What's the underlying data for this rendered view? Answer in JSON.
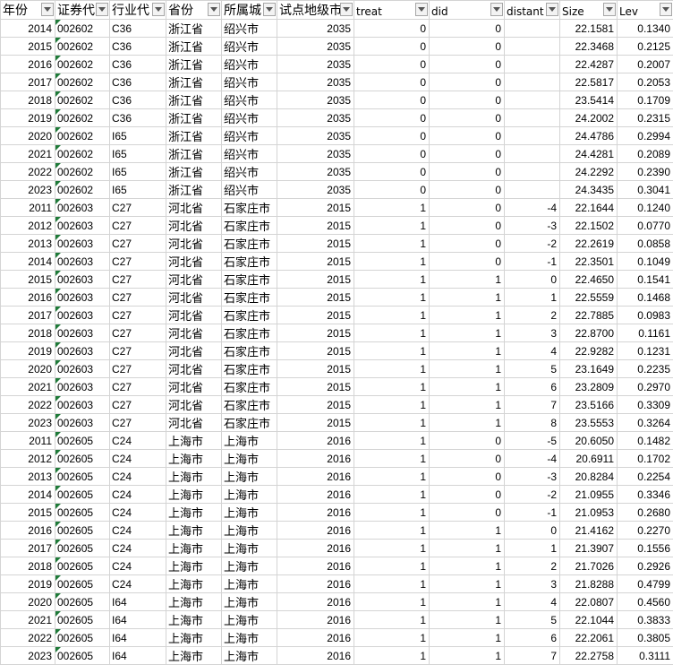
{
  "columns": [
    "年份",
    "证券代",
    "行业代",
    "省份",
    "所属城",
    "试点地级市",
    "treat",
    "did",
    "distant",
    "Size",
    "Lev"
  ],
  "rows": [
    [
      "2014",
      "002602",
      "C36",
      "浙江省",
      "绍兴市",
      "2035",
      "0",
      "0",
      "",
      "22.1581",
      "0.1340"
    ],
    [
      "2015",
      "002602",
      "C36",
      "浙江省",
      "绍兴市",
      "2035",
      "0",
      "0",
      "",
      "22.3468",
      "0.2125"
    ],
    [
      "2016",
      "002602",
      "C36",
      "浙江省",
      "绍兴市",
      "2035",
      "0",
      "0",
      "",
      "22.4287",
      "0.2007"
    ],
    [
      "2017",
      "002602",
      "C36",
      "浙江省",
      "绍兴市",
      "2035",
      "0",
      "0",
      "",
      "22.5817",
      "0.2053"
    ],
    [
      "2018",
      "002602",
      "C36",
      "浙江省",
      "绍兴市",
      "2035",
      "0",
      "0",
      "",
      "23.5414",
      "0.1709"
    ],
    [
      "2019",
      "002602",
      "C36",
      "浙江省",
      "绍兴市",
      "2035",
      "0",
      "0",
      "",
      "24.2002",
      "0.2315"
    ],
    [
      "2020",
      "002602",
      "I65",
      "浙江省",
      "绍兴市",
      "2035",
      "0",
      "0",
      "",
      "24.4786",
      "0.2994"
    ],
    [
      "2021",
      "002602",
      "I65",
      "浙江省",
      "绍兴市",
      "2035",
      "0",
      "0",
      "",
      "24.4281",
      "0.2089"
    ],
    [
      "2022",
      "002602",
      "I65",
      "浙江省",
      "绍兴市",
      "2035",
      "0",
      "0",
      "",
      "24.2292",
      "0.2390"
    ],
    [
      "2023",
      "002602",
      "I65",
      "浙江省",
      "绍兴市",
      "2035",
      "0",
      "0",
      "",
      "24.3435",
      "0.3041"
    ],
    [
      "2011",
      "002603",
      "C27",
      "河北省",
      "石家庄市",
      "2015",
      "1",
      "0",
      "-4",
      "22.1644",
      "0.1240"
    ],
    [
      "2012",
      "002603",
      "C27",
      "河北省",
      "石家庄市",
      "2015",
      "1",
      "0",
      "-3",
      "22.1502",
      "0.0770"
    ],
    [
      "2013",
      "002603",
      "C27",
      "河北省",
      "石家庄市",
      "2015",
      "1",
      "0",
      "-2",
      "22.2619",
      "0.0858"
    ],
    [
      "2014",
      "002603",
      "C27",
      "河北省",
      "石家庄市",
      "2015",
      "1",
      "0",
      "-1",
      "22.3501",
      "0.1049"
    ],
    [
      "2015",
      "002603",
      "C27",
      "河北省",
      "石家庄市",
      "2015",
      "1",
      "1",
      "0",
      "22.4650",
      "0.1541"
    ],
    [
      "2016",
      "002603",
      "C27",
      "河北省",
      "石家庄市",
      "2015",
      "1",
      "1",
      "1",
      "22.5559",
      "0.1468"
    ],
    [
      "2017",
      "002603",
      "C27",
      "河北省",
      "石家庄市",
      "2015",
      "1",
      "1",
      "2",
      "22.7885",
      "0.0983"
    ],
    [
      "2018",
      "002603",
      "C27",
      "河北省",
      "石家庄市",
      "2015",
      "1",
      "1",
      "3",
      "22.8700",
      "0.1161"
    ],
    [
      "2019",
      "002603",
      "C27",
      "河北省",
      "石家庄市",
      "2015",
      "1",
      "1",
      "4",
      "22.9282",
      "0.1231"
    ],
    [
      "2020",
      "002603",
      "C27",
      "河北省",
      "石家庄市",
      "2015",
      "1",
      "1",
      "5",
      "23.1649",
      "0.2235"
    ],
    [
      "2021",
      "002603",
      "C27",
      "河北省",
      "石家庄市",
      "2015",
      "1",
      "1",
      "6",
      "23.2809",
      "0.2970"
    ],
    [
      "2022",
      "002603",
      "C27",
      "河北省",
      "石家庄市",
      "2015",
      "1",
      "1",
      "7",
      "23.5166",
      "0.3309"
    ],
    [
      "2023",
      "002603",
      "C27",
      "河北省",
      "石家庄市",
      "2015",
      "1",
      "1",
      "8",
      "23.5553",
      "0.3264"
    ],
    [
      "2011",
      "002605",
      "C24",
      "上海市",
      "上海市",
      "2016",
      "1",
      "0",
      "-5",
      "20.6050",
      "0.1482"
    ],
    [
      "2012",
      "002605",
      "C24",
      "上海市",
      "上海市",
      "2016",
      "1",
      "0",
      "-4",
      "20.6911",
      "0.1702"
    ],
    [
      "2013",
      "002605",
      "C24",
      "上海市",
      "上海市",
      "2016",
      "1",
      "0",
      "-3",
      "20.8284",
      "0.2254"
    ],
    [
      "2014",
      "002605",
      "C24",
      "上海市",
      "上海市",
      "2016",
      "1",
      "0",
      "-2",
      "21.0955",
      "0.3346"
    ],
    [
      "2015",
      "002605",
      "C24",
      "上海市",
      "上海市",
      "2016",
      "1",
      "0",
      "-1",
      "21.0953",
      "0.2680"
    ],
    [
      "2016",
      "002605",
      "C24",
      "上海市",
      "上海市",
      "2016",
      "1",
      "1",
      "0",
      "21.4162",
      "0.2270"
    ],
    [
      "2017",
      "002605",
      "C24",
      "上海市",
      "上海市",
      "2016",
      "1",
      "1",
      "1",
      "21.3907",
      "0.1556"
    ],
    [
      "2018",
      "002605",
      "C24",
      "上海市",
      "上海市",
      "2016",
      "1",
      "1",
      "2",
      "21.7026",
      "0.2926"
    ],
    [
      "2019",
      "002605",
      "C24",
      "上海市",
      "上海市",
      "2016",
      "1",
      "1",
      "3",
      "21.8288",
      "0.4799"
    ],
    [
      "2020",
      "002605",
      "I64",
      "上海市",
      "上海市",
      "2016",
      "1",
      "1",
      "4",
      "22.0807",
      "0.4560"
    ],
    [
      "2021",
      "002605",
      "I64",
      "上海市",
      "上海市",
      "2016",
      "1",
      "1",
      "5",
      "22.1044",
      "0.3833"
    ],
    [
      "2022",
      "002605",
      "I64",
      "上海市",
      "上海市",
      "2016",
      "1",
      "1",
      "6",
      "22.2061",
      "0.3805"
    ],
    [
      "2023",
      "002605",
      "I64",
      "上海市",
      "上海市",
      "2016",
      "1",
      "1",
      "7",
      "22.2758",
      "0.3111"
    ]
  ],
  "colors": {
    "gridline": "#d4d4d4",
    "error_triangle": "#1e7a38"
  },
  "icons": {
    "header_filter": "filter-dropdown-icon"
  }
}
